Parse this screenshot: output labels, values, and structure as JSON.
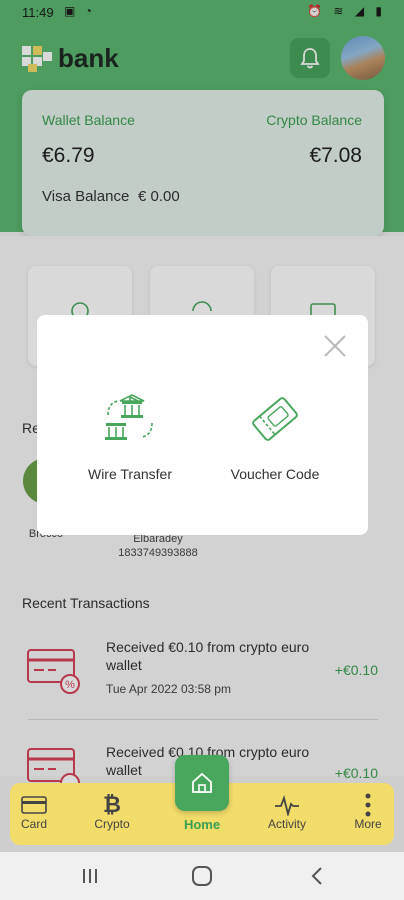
{
  "status_bar": {
    "time": "11:49",
    "left_icons": "▣ ◔",
    "right_icons": "⏰ ≋ ◢ ▮"
  },
  "header": {
    "brand": "bank"
  },
  "balances": {
    "wallet_label": "Wallet Balance",
    "wallet_value": "€6.79",
    "crypto_label": "Crypto Balance",
    "crypto_value": "€7.08",
    "visa_label": "Visa Balance",
    "visa_value": "€ 0.00"
  },
  "beneficiaries": {
    "title": "Rec",
    "items": [
      {
        "name_line1": "Ver",
        "name_line2": "Brocco",
        "number": ""
      },
      {
        "name_line1": "Elbaradey",
        "name_line2": "",
        "number": "1833749393888"
      }
    ]
  },
  "transactions": {
    "title": "Recent Transactions",
    "items": [
      {
        "description": "Received €0.10 from crypto euro wallet",
        "date": "Tue Apr 2022 03:58 pm",
        "amount": "+€0.10"
      },
      {
        "description": "Received €0.10 from crypto euro wallet",
        "date": "",
        "amount": "+€0.10"
      }
    ]
  },
  "modal": {
    "options": [
      {
        "label": "Wire Transfer",
        "icon": "bank-transfer-icon"
      },
      {
        "label": "Voucher Code",
        "icon": "voucher-ticket-icon"
      }
    ]
  },
  "nav": {
    "items": [
      {
        "label": "Card",
        "icon": "card-icon"
      },
      {
        "label": "Crypto",
        "icon": "bitcoin-icon"
      },
      {
        "label": "Home",
        "icon": "home-icon"
      },
      {
        "label": "Activity",
        "icon": "activity-icon"
      },
      {
        "label": "More",
        "icon": "more-vertical-icon"
      }
    ]
  },
  "colors": {
    "brand_green": "#5cb870",
    "accent_green": "#3aa051",
    "nav_yellow": "#f2dc6a",
    "tx_icon_red": "#d9445a"
  }
}
